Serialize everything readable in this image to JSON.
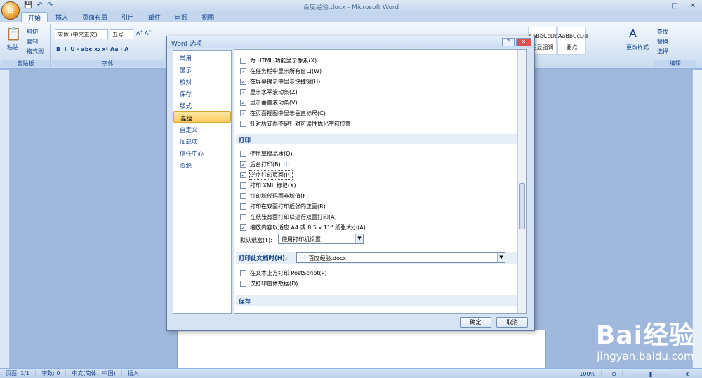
{
  "window": {
    "title": "百度经验.docx - Microsoft Word"
  },
  "tabs": [
    "开始",
    "插入",
    "页面布局",
    "引用",
    "邮件",
    "审阅",
    "视图"
  ],
  "ribbon": {
    "clipboard": {
      "paste": "粘贴",
      "cut": "剪切",
      "copy": "复制",
      "format_painter": "格式刷",
      "label": "剪贴板"
    },
    "font": {
      "font_name": "宋体 (中文正文)",
      "font_size": "五号",
      "label": "字体"
    },
    "styles": [
      {
        "sample": "AaBbCcDd",
        "name": "明显强调"
      },
      {
        "sample": "AaBbCcDd",
        "name": "要点"
      }
    ],
    "change_styles": "更改样式",
    "editing": {
      "find": "查找",
      "replace": "替换",
      "select": "选择",
      "label": "编辑"
    }
  },
  "dialog": {
    "title": "Word 选项",
    "nav": [
      "常用",
      "显示",
      "校对",
      "保存",
      "版式",
      "高级",
      "自定义",
      "加载项",
      "信任中心",
      "资源"
    ],
    "active_nav": "高级",
    "options_top": [
      {
        "label": "为 HTML 功能显示像素(X)",
        "checked": false
      },
      {
        "label": "在任务栏中显示所有窗口(W)",
        "checked": true
      },
      {
        "label": "在屏幕提示中显示快捷键(H)",
        "checked": true
      },
      {
        "label": "显示水平滚动条(Z)",
        "checked": true
      },
      {
        "label": "显示垂直滚动条(V)",
        "checked": true
      },
      {
        "label": "在页面视图中显示垂直标尺(C)",
        "checked": true
      },
      {
        "label": "针对版式而不是针对可读性优化字符位置",
        "checked": false
      }
    ],
    "print_section": "打印",
    "print_options": [
      {
        "label": "使用草稿品质(Q)",
        "checked": false
      },
      {
        "label": "后台打印(B)",
        "checked": true
      },
      {
        "label": "逆序打印页面(R)",
        "checked": true
      },
      {
        "label": "打印 XML 标记(X)",
        "checked": false
      },
      {
        "label": "打印域代码而非域值(F)",
        "checked": false
      },
      {
        "label": "打印在双面打印纸张的正面(R)",
        "checked": false
      },
      {
        "label": "在纸张背面打印以进行双面打印(A)",
        "checked": false
      },
      {
        "label": "缩放内容以适应 A4 或 8.5 x 11\" 纸张大小(A)",
        "checked": true
      }
    ],
    "default_tray_label": "默认纸盒(T):",
    "default_tray_value": "使用打印机设置",
    "print_doc_label": "打印此文档时(H):",
    "print_doc_value": "百度经验.docx",
    "doc_options": [
      {
        "label": "在文本上方打印 PostScript(P)",
        "checked": false
      },
      {
        "label": "仅打印窗体数据(D)",
        "checked": false
      }
    ],
    "save_section": "保存",
    "ok": "确定",
    "cancel": "取消"
  },
  "statusbar": {
    "page": "页面: 1/1",
    "words": "字数: 0",
    "lang": "中文(简体，中国)",
    "mode": "插入",
    "zoom": "100%"
  },
  "watermark": {
    "logo": "Bai经验",
    "url": "jingyan.baidu.com"
  }
}
